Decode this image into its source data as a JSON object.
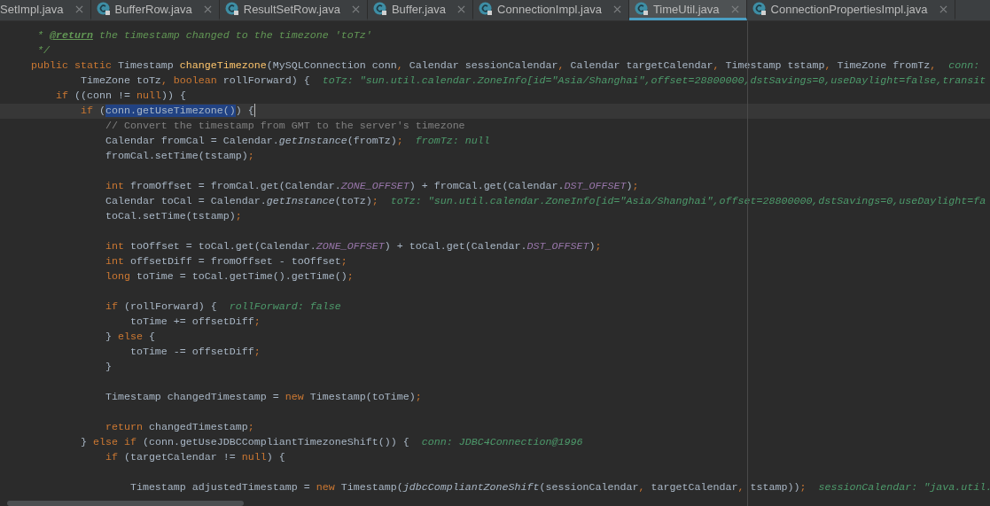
{
  "tabs": [
    {
      "label": "SetImpl.java",
      "selected": false,
      "icon": false
    },
    {
      "label": "BufferRow.java",
      "selected": false,
      "icon": true
    },
    {
      "label": "ResultSetRow.java",
      "selected": false,
      "icon": true
    },
    {
      "label": "Buffer.java",
      "selected": false,
      "icon": true
    },
    {
      "label": "ConnectionImpl.java",
      "selected": false,
      "icon": true
    },
    {
      "label": "TimeUtil.java",
      "selected": true,
      "icon": true
    },
    {
      "label": "ConnectionPropertiesImpl.java",
      "selected": false,
      "icon": true
    }
  ],
  "editor": {
    "lines": [
      {
        "current": false,
        "tokens": [
          {
            "kind": "doc",
            "t": "      * "
          },
          {
            "kind": "tag",
            "t": "@return"
          },
          {
            "kind": "doc",
            "t": " the timestamp changed to the timezone 'toTz'"
          }
        ]
      },
      {
        "current": false,
        "tokens": [
          {
            "kind": "doc",
            "t": "      */"
          }
        ]
      },
      {
        "current": false,
        "tokens": [
          {
            "kind": "keyword",
            "t": "     public static "
          },
          {
            "kind": "plain",
            "t": "Timestamp "
          },
          {
            "kind": "function",
            "t": "changeTimezone"
          },
          {
            "kind": "plain",
            "t": "(MySQLConnection conn"
          },
          {
            "kind": "punctuation",
            "t": ","
          },
          {
            "kind": "plain",
            "t": " Calendar sessionCalendar"
          },
          {
            "kind": "punctuation",
            "t": ","
          },
          {
            "kind": "plain",
            "t": " Calendar targetCalendar"
          },
          {
            "kind": "punctuation",
            "t": ","
          },
          {
            "kind": "plain",
            "t": " Timestamp tstamp"
          },
          {
            "kind": "punctuation",
            "t": ","
          },
          {
            "kind": "plain",
            "t": " TimeZone fromTz"
          },
          {
            "kind": "punctuation",
            "t": ","
          }
        ],
        "hint": "conn:"
      },
      {
        "current": false,
        "tokens": [
          {
            "kind": "plain",
            "t": "             TimeZone toTz"
          },
          {
            "kind": "punctuation",
            "t": ","
          },
          {
            "kind": "keyword",
            "t": " boolean "
          },
          {
            "kind": "plain",
            "t": "rollForward) {"
          }
        ],
        "hint": "toTz: \"sun.util.calendar.ZoneInfo[id=\"Asia/Shanghai\",offset=28800000,dstSavings=0,useDaylight=false,transit"
      },
      {
        "current": false,
        "tokens": [
          {
            "kind": "keyword",
            "t": "         if "
          },
          {
            "kind": "plain",
            "t": "((conn != "
          },
          {
            "kind": "keyword",
            "t": "null"
          },
          {
            "kind": "plain",
            "t": ")) {"
          }
        ]
      },
      {
        "current": true,
        "tokens": [
          {
            "kind": "keyword",
            "t": "             if "
          },
          {
            "kind": "plain",
            "t": "("
          },
          {
            "kind": "selection",
            "t": "conn.getUseTimezone()"
          },
          {
            "kind": "plain",
            "t": ") {"
          }
        ]
      },
      {
        "current": false,
        "tokens": [
          {
            "kind": "comment",
            "t": "                 // Convert the timestamp from GMT to the server's timezone"
          }
        ]
      },
      {
        "current": false,
        "tokens": [
          {
            "kind": "plain",
            "t": "                 Calendar fromCal = Calendar."
          },
          {
            "kind": "italic",
            "t": "getInstance"
          },
          {
            "kind": "plain",
            "t": "(fromTz)"
          },
          {
            "kind": "punctuation",
            "t": ";"
          }
        ],
        "hint": "fromTz: null"
      },
      {
        "current": false,
        "tokens": [
          {
            "kind": "plain",
            "t": "                 fromCal.setTime(tstamp)"
          },
          {
            "kind": "punctuation",
            "t": ";"
          }
        ]
      },
      {
        "current": false
      },
      {
        "current": false,
        "tokens": [
          {
            "kind": "keyword",
            "t": "                 int "
          },
          {
            "kind": "plain",
            "t": "fromOffset = fromCal.get(Calendar."
          },
          {
            "kind": "constant",
            "t": "ZONE_OFFSET"
          },
          {
            "kind": "plain",
            "t": ") + fromCal.get(Calendar."
          },
          {
            "kind": "constant",
            "t": "DST_OFFSET"
          },
          {
            "kind": "plain",
            "t": ")"
          },
          {
            "kind": "punctuation",
            "t": ";"
          }
        ]
      },
      {
        "current": false,
        "tokens": [
          {
            "kind": "plain",
            "t": "                 Calendar toCal = Calendar."
          },
          {
            "kind": "italic",
            "t": "getInstance"
          },
          {
            "kind": "plain",
            "t": "(toTz)"
          },
          {
            "kind": "punctuation",
            "t": ";"
          }
        ],
        "hint": "toTz: \"sun.util.calendar.ZoneInfo[id=\"Asia/Shanghai\",offset=28800000,dstSavings=0,useDaylight=fa"
      },
      {
        "current": false,
        "tokens": [
          {
            "kind": "plain",
            "t": "                 toCal.setTime(tstamp)"
          },
          {
            "kind": "punctuation",
            "t": ";"
          }
        ]
      },
      {
        "current": false
      },
      {
        "current": false,
        "tokens": [
          {
            "kind": "keyword",
            "t": "                 int "
          },
          {
            "kind": "plain",
            "t": "toOffset = toCal.get(Calendar."
          },
          {
            "kind": "constant",
            "t": "ZONE_OFFSET"
          },
          {
            "kind": "plain",
            "t": ") + toCal.get(Calendar."
          },
          {
            "kind": "constant",
            "t": "DST_OFFSET"
          },
          {
            "kind": "plain",
            "t": ")"
          },
          {
            "kind": "punctuation",
            "t": ";"
          }
        ]
      },
      {
        "current": false,
        "tokens": [
          {
            "kind": "keyword",
            "t": "                 int "
          },
          {
            "kind": "plain",
            "t": "offsetDiff = fromOffset - toOffset"
          },
          {
            "kind": "punctuation",
            "t": ";"
          }
        ]
      },
      {
        "current": false,
        "tokens": [
          {
            "kind": "keyword",
            "t": "                 long "
          },
          {
            "kind": "plain",
            "t": "toTime = toCal.getTime().getTime()"
          },
          {
            "kind": "punctuation",
            "t": ";"
          }
        ]
      },
      {
        "current": false
      },
      {
        "current": false,
        "tokens": [
          {
            "kind": "keyword",
            "t": "                 if "
          },
          {
            "kind": "plain",
            "t": "(rollForward) {"
          }
        ],
        "hint": "rollForward: false"
      },
      {
        "current": false,
        "tokens": [
          {
            "kind": "plain",
            "t": "                     toTime += offsetDiff"
          },
          {
            "kind": "punctuation",
            "t": ";"
          }
        ]
      },
      {
        "current": false,
        "tokens": [
          {
            "kind": "plain",
            "t": "                 } "
          },
          {
            "kind": "keyword",
            "t": "else "
          },
          {
            "kind": "plain",
            "t": "{"
          }
        ]
      },
      {
        "current": false,
        "tokens": [
          {
            "kind": "plain",
            "t": "                     toTime -= offsetDiff"
          },
          {
            "kind": "punctuation",
            "t": ";"
          }
        ]
      },
      {
        "current": false,
        "tokens": [
          {
            "kind": "plain",
            "t": "                 }"
          }
        ]
      },
      {
        "current": false
      },
      {
        "current": false,
        "tokens": [
          {
            "kind": "plain",
            "t": "                 Timestamp changedTimestamp = "
          },
          {
            "kind": "keyword",
            "t": "new "
          },
          {
            "kind": "plain",
            "t": "Timestamp(toTime)"
          },
          {
            "kind": "punctuation",
            "t": ";"
          }
        ]
      },
      {
        "current": false
      },
      {
        "current": false,
        "tokens": [
          {
            "kind": "keyword",
            "t": "                 return "
          },
          {
            "kind": "plain",
            "t": "changedTimestamp"
          },
          {
            "kind": "punctuation",
            "t": ";"
          }
        ]
      },
      {
        "current": false,
        "tokens": [
          {
            "kind": "plain",
            "t": "             } "
          },
          {
            "kind": "keyword",
            "t": "else if "
          },
          {
            "kind": "plain",
            "t": "(conn.getUseJDBCCompliantTimezoneShift()) {"
          }
        ],
        "hint": "conn: JDBC4Connection@1996"
      },
      {
        "current": false,
        "tokens": [
          {
            "kind": "keyword",
            "t": "                 if "
          },
          {
            "kind": "plain",
            "t": "(targetCalendar != "
          },
          {
            "kind": "keyword",
            "t": "null"
          },
          {
            "kind": "plain",
            "t": ") {"
          }
        ]
      },
      {
        "current": false
      },
      {
        "current": false,
        "tokens": [
          {
            "kind": "plain",
            "t": "                     Timestamp adjustedTimestamp = "
          },
          {
            "kind": "keyword",
            "t": "new "
          },
          {
            "kind": "plain",
            "t": "Timestamp("
          },
          {
            "kind": "italic",
            "t": "jdbcCompliantZoneShift"
          },
          {
            "kind": "plain",
            "t": "(sessionCalendar"
          },
          {
            "kind": "punctuation",
            "t": ","
          },
          {
            "kind": "plain",
            "t": " targetCalendar"
          },
          {
            "kind": "punctuation",
            "t": ","
          },
          {
            "kind": "plain",
            "t": " tstamp))"
          },
          {
            "kind": "punctuation",
            "t": ";"
          }
        ],
        "hint": "sessionCalendar: \"java.util."
      }
    ]
  }
}
